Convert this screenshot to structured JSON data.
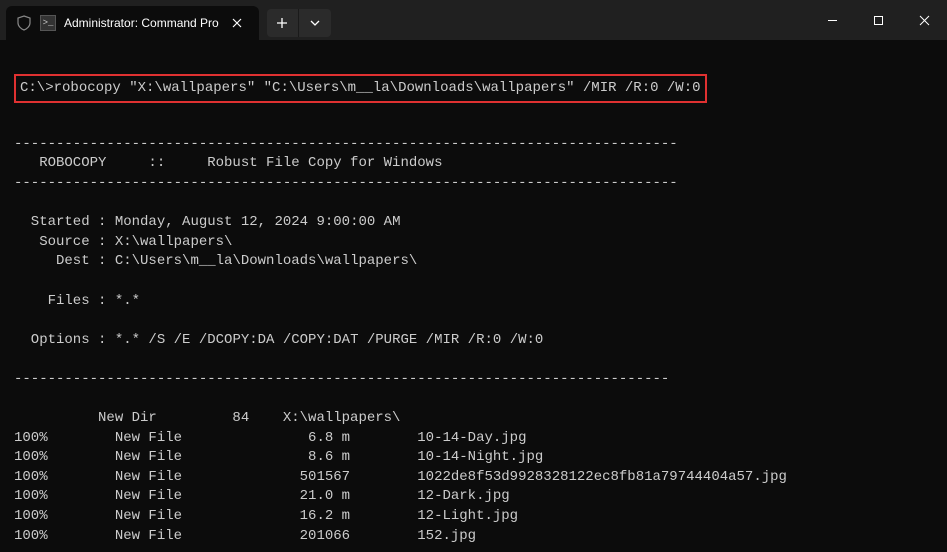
{
  "titlebar": {
    "tab_title": "Administrator: Command Pro",
    "cmd_icon_text": ">_"
  },
  "terminal": {
    "prompt": "C:\\>",
    "command": "robocopy \"X:\\wallpapers\" \"C:\\Users\\m__la\\Downloads\\wallpapers\" /MIR /R:0 /W:0",
    "sep": "-------------------------------------------------------------------------------",
    "header": "   ROBOCOPY     ::     Robust File Copy for Windows",
    "started_label": "  Started : ",
    "started_value": "Monday, August 12, 2024 9:00:00 AM",
    "source_label": "   Source : ",
    "source_value": "X:\\wallpapers\\",
    "dest_label": "     Dest : ",
    "dest_value": "C:\\Users\\m__la\\Downloads\\wallpapers\\",
    "files_label": "    Files : ",
    "files_value": "*.*",
    "options_label": "  Options : ",
    "options_value": "*.* /S /E /DCOPY:DA /COPY:DAT /PURGE /MIR /R:0 /W:0",
    "sep2": "------------------------------------------------------------------------------",
    "dir_line": "          New Dir         84    X:\\wallpapers\\",
    "files": [
      "100%        New File               6.8 m        10-14-Day.jpg",
      "100%        New File               8.6 m        10-14-Night.jpg",
      "100%        New File              501567        1022de8f53d9928328122ec8fb81a79744404a57.jpg",
      "100%        New File              21.0 m        12-Dark.jpg",
      "100%        New File              16.2 m        12-Light.jpg",
      "100%        New File              201066        152.jpg"
    ]
  }
}
